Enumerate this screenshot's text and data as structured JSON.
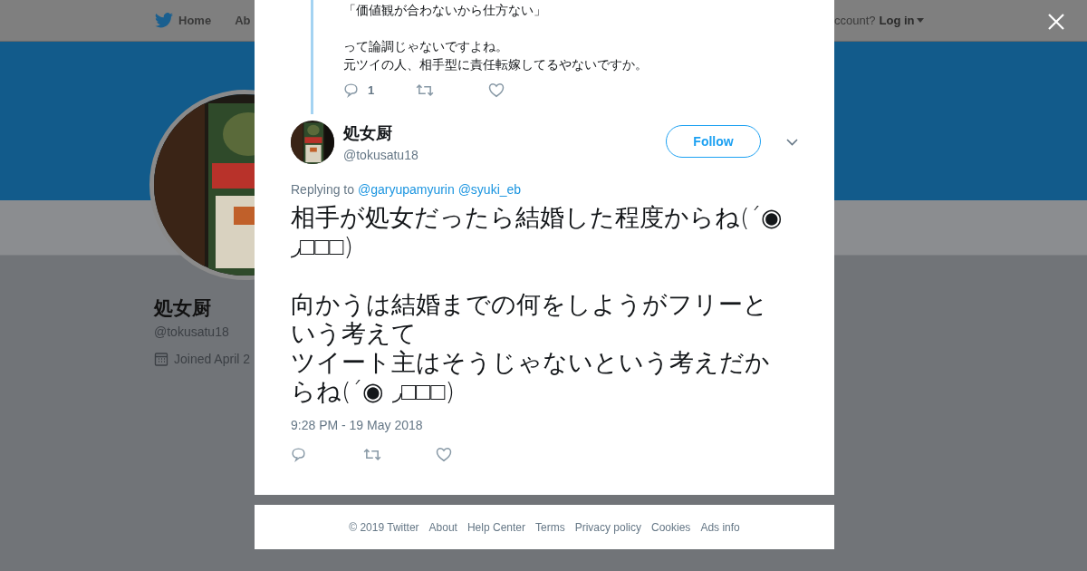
{
  "background_page": {
    "nav": {
      "items": [
        {
          "label": "Home"
        },
        {
          "label": "Ab"
        }
      ],
      "account_prompt": "ccount?",
      "login": "Log in"
    },
    "profile": {
      "name": "処女厨",
      "handle": "@tokusatu18",
      "joined": "Joined April 2"
    }
  },
  "parent_tweet": {
    "paragraphs": [
      [
        "「価値観が合わないから仕方ない」"
      ],
      [
        "って論調じゃないですよね。",
        "元ツイの人、相手型に責任転嫁してるやないですか。"
      ]
    ],
    "reply_count": "1"
  },
  "tweet": {
    "author": {
      "name": "処女厨",
      "handle": "@tokusatu18"
    },
    "follow_button": "Follow",
    "replying_label": "Replying to",
    "mentions": [
      "@garyupamyurin",
      "@syuki_eb"
    ],
    "paragraphs": [
      [
        "相手が処女だったら結婚した程度からね(´◉ ◞□□□)"
      ],
      [
        "向かうは結婚までの何をしようがフリーという考えて",
        "ツイート主はそうじゃないという考えだからね(´◉ ◞□□□)"
      ]
    ],
    "timestamp": "9:28 PM - 19 May 2018"
  },
  "footer": [
    "© 2019 Twitter",
    "About",
    "Help Center",
    "Terms",
    "Privacy policy",
    "Cookies",
    "Ads info"
  ]
}
